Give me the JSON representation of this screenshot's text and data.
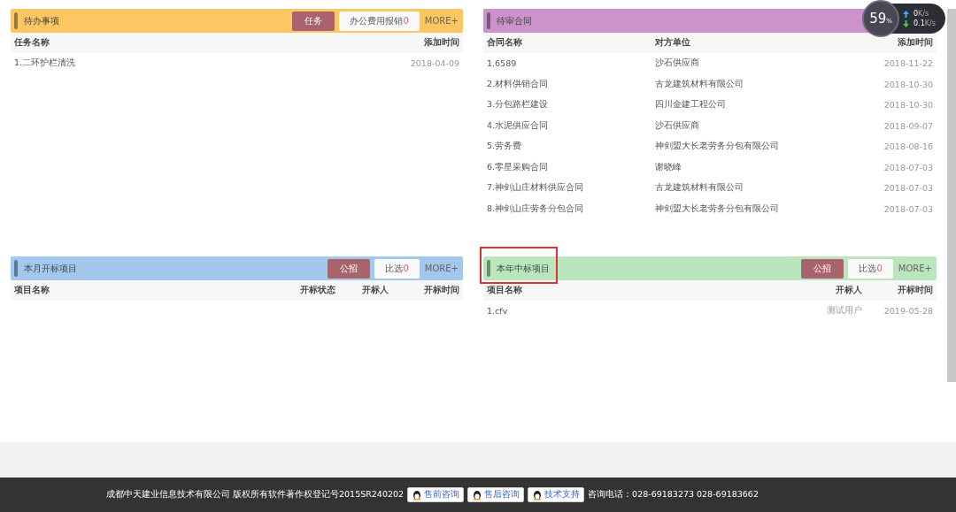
{
  "panels": [
    {
      "title": "待办事项",
      "color": "#fcc762",
      "highlighted": false,
      "tabs": [
        {
          "label": "任务",
          "selected": true
        },
        {
          "label": "办公费用报销",
          "count": "0",
          "selected": false
        }
      ],
      "more": "MORE+",
      "columns": [
        {
          "label": "任务名称",
          "kind": "name"
        },
        {
          "label": "添加时间",
          "kind": "date"
        }
      ],
      "rows": [
        [
          "1.二环护栏清洗",
          "2018-04-09"
        ]
      ]
    },
    {
      "title": "待审合同",
      "color": "#cc92cc",
      "highlighted": false,
      "columns": [
        {
          "label": "合同名称",
          "kind": "short"
        },
        {
          "label": "对方单位",
          "kind": "name"
        },
        {
          "label": "添加时间",
          "kind": "date"
        }
      ],
      "rows": [
        [
          "1.6589",
          "沙石供应商",
          "2018-11-22"
        ],
        [
          "2.材料供销合同",
          "古龙建筑材料有限公司",
          "2018-10-30"
        ],
        [
          "3.分包路栏建设",
          "四川金建工程公司",
          "2018-10-30"
        ],
        [
          "4.水泥供应合同",
          "沙石供应商",
          "2018-09-07"
        ],
        [
          "5.劳务费",
          "神剑盟大长老劳务分包有限公司",
          "2018-08-16"
        ],
        [
          "6.零星采购合同",
          "谢晓峰",
          "2018-07-03"
        ],
        [
          "7.神剑山庄材料供应合同",
          "古龙建筑材料有限公司",
          "2018-07-03"
        ],
        [
          "8.神剑山庄劳务分包合同",
          "神剑盟大长老劳务分包有限公司",
          "2018-07-03"
        ]
      ]
    },
    {
      "title": "本月开标项目",
      "color": "#a3c8ee",
      "highlighted": false,
      "tabs": [
        {
          "label": "公招",
          "selected": true
        },
        {
          "label": "比选",
          "count": "0",
          "selected": false
        }
      ],
      "more": "MORE+",
      "columns": [
        {
          "label": "项目名称",
          "kind": "name"
        },
        {
          "label": "开标状态",
          "kind": "status"
        },
        {
          "label": "开标人",
          "kind": "person"
        },
        {
          "label": "开标时间",
          "kind": "date"
        }
      ]
    },
    {
      "title": "本年中标项目",
      "color": "#b9e6bd",
      "highlighted": true,
      "tabs": [
        {
          "label": "公招",
          "selected": true
        },
        {
          "label": "比选",
          "count": "0",
          "selected": false
        }
      ],
      "more": "MORE+",
      "columns": [
        {
          "label": "项目名称",
          "kind": "name"
        },
        {
          "label": "开标人",
          "kind": "date"
        },
        {
          "label": "开标时间",
          "kind": "date"
        }
      ],
      "rows": [
        [
          "1.cfv",
          "测试用户",
          "2019-05-28"
        ]
      ]
    }
  ],
  "speed_widget": {
    "percent": "59",
    "unit": "%",
    "upload": "0",
    "upload_unit": "K/s",
    "download": "0.1",
    "download_unit": "K/s"
  },
  "footer": {
    "copyright": "成都中天建业信息技术有限公司 版权所有软件著作权登记号2015SR240202",
    "buttons": [
      "售前咨询",
      "售后咨询",
      "技术支持"
    ],
    "phone": "咨询电话：028-69183273 028-69183662"
  }
}
